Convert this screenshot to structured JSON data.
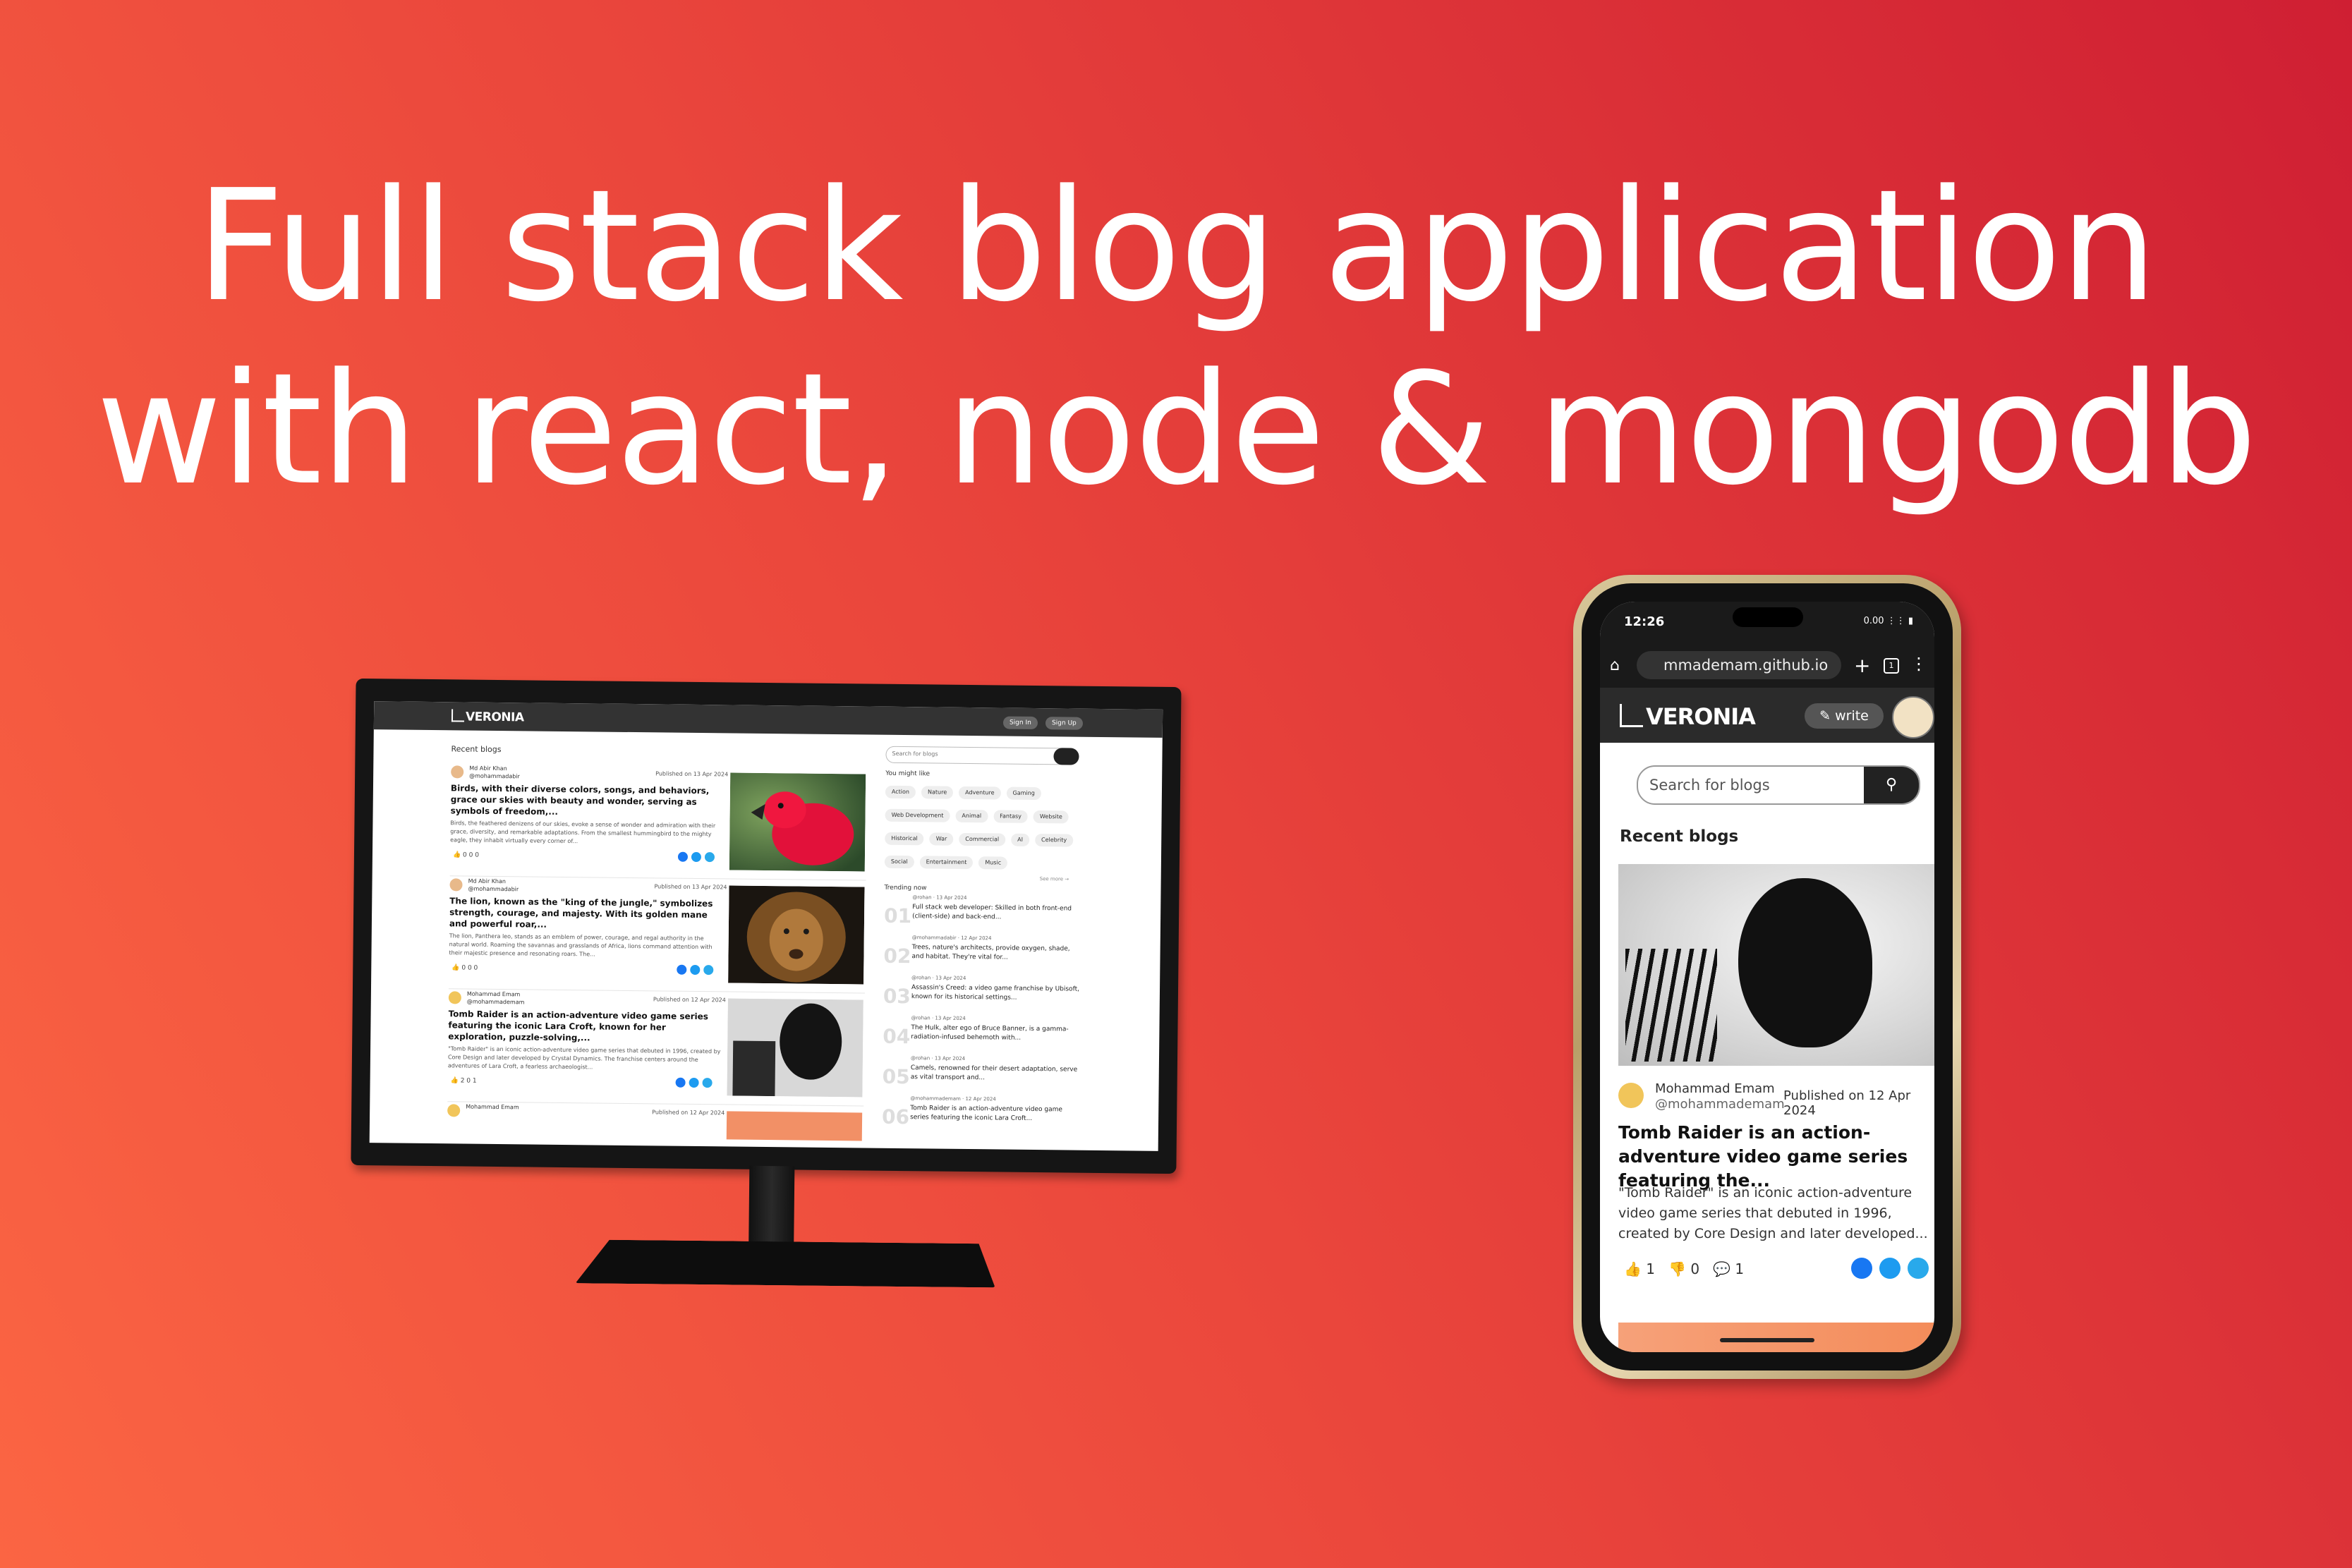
{
  "headline": {
    "line1": "Full stack blog application",
    "line2": "with react, node & mongodb"
  },
  "desktop": {
    "brand": "VERONIA",
    "nav_buttons": [
      "Sign In",
      "Sign Up"
    ],
    "recent_blogs_label": "Recent blogs",
    "posts": [
      {
        "author": "Md Abir Khan",
        "handle": "@mohammadabir",
        "date": "Published on 13 Apr 2024",
        "title": "Birds, with their diverse colors, songs, and behaviors, grace our skies with beauty and wonder, serving as symbols of freedom,...",
        "desc": "Birds, the feathered denizens of our skies, evoke a sense of wonder and admiration with their grace, diversity, and remarkable adaptations. From the smallest hummingbird to the mighty eagle, they inhabit virtually every corner of...",
        "stats": "0  0  0"
      },
      {
        "author": "Md Abir Khan",
        "handle": "@mohammadabir",
        "date": "Published on 13 Apr 2024",
        "title": "The lion, known as the \"king of the jungle,\" symbolizes strength, courage, and majesty. With its golden mane and powerful roar,...",
        "desc": "The lion, Panthera leo, stands as an emblem of power, courage, and regal authority in the natural world. Roaming the savannas and grasslands of Africa, lions command attention with their majestic presence and resonating roars. The...",
        "stats": "0  0  0"
      },
      {
        "author": "Mohammad Emam",
        "handle": "@mohammademam",
        "date": "Published on 12 Apr 2024",
        "title": "Tomb Raider is an action-adventure video game series featuring the iconic Lara Croft, known for her exploration, puzzle-solving,...",
        "desc": "\"Tomb Raider\" is an iconic action-adventure video game series that debuted in 1996, created by Core Design and later developed by Crystal Dynamics. The franchise centers around the adventures of Lara Croft, a fearless archaeologist...",
        "stats": "2  0  1"
      },
      {
        "author": "Mohammad Emam",
        "handle": "",
        "date": "Published on 12 Apr 2024",
        "title": "",
        "desc": "",
        "stats": ""
      }
    ],
    "search_placeholder": "Search for blogs",
    "might_like_label": "You might like",
    "tags": [
      "Action",
      "Nature",
      "Adventure",
      "Gaming",
      "Web Development",
      "Animal",
      "Fantasy",
      "Website",
      "Historical",
      "War",
      "Commercial",
      "AI",
      "Celebrity",
      "Social",
      "Entertainment",
      "Music"
    ],
    "see_more": "See more →",
    "trending_label": "Trending now",
    "trending": [
      {
        "num": "01",
        "meta": "@rohan  · 13 Apr 2024",
        "text": "Full stack web developer: Skilled in both front-end (client-side) and back-end..."
      },
      {
        "num": "02",
        "meta": "@mohammadabir  · 12 Apr 2024",
        "text": "Trees, nature's architects, provide oxygen, shade, and habitat. They're vital for..."
      },
      {
        "num": "03",
        "meta": "@rohan  · 13 Apr 2024",
        "text": "Assassin's Creed: a video game franchise by Ubisoft, known for its historical settings..."
      },
      {
        "num": "04",
        "meta": "@rohan  · 13 Apr 2024",
        "text": "The Hulk, alter ego of Bruce Banner, is a gamma-radiation-infused behemoth with..."
      },
      {
        "num": "05",
        "meta": "@rohan  · 13 Apr 2024",
        "text": "Camels, renowned for their desert adaptation, serve as vital transport and..."
      },
      {
        "num": "06",
        "meta": "@mohammademam  · 12 Apr 2024",
        "text": "Tomb Raider is an action-adventure video game series featuring the iconic Lara Croft..."
      }
    ]
  },
  "phone": {
    "time": "12:26",
    "status_icons": "0.00  ⋮⋮ ▮",
    "url": "mmademam.github.io",
    "tab_count": "1",
    "brand": "VERONIA",
    "write_label": "write",
    "search_placeholder": "Search for blogs",
    "recent_blogs_label": "Recent blogs",
    "post": {
      "author": "Mohammad Emam",
      "handle": "@mohammademam",
      "date": "Published on 12 Apr 2024",
      "title": "Tomb Raider is an action-adventure video game series featuring the...",
      "desc": "\"Tomb Raider\" is an iconic action-adventure video game series that debuted in 1996, created by Core Design and later developed...",
      "likes": "1",
      "dislikes": "0",
      "comments": "1"
    }
  },
  "colors": {
    "facebook": "#1877f2",
    "twitter": "#1d9bf0",
    "telegram": "#29a9eb",
    "nav_dark": "#333333"
  }
}
